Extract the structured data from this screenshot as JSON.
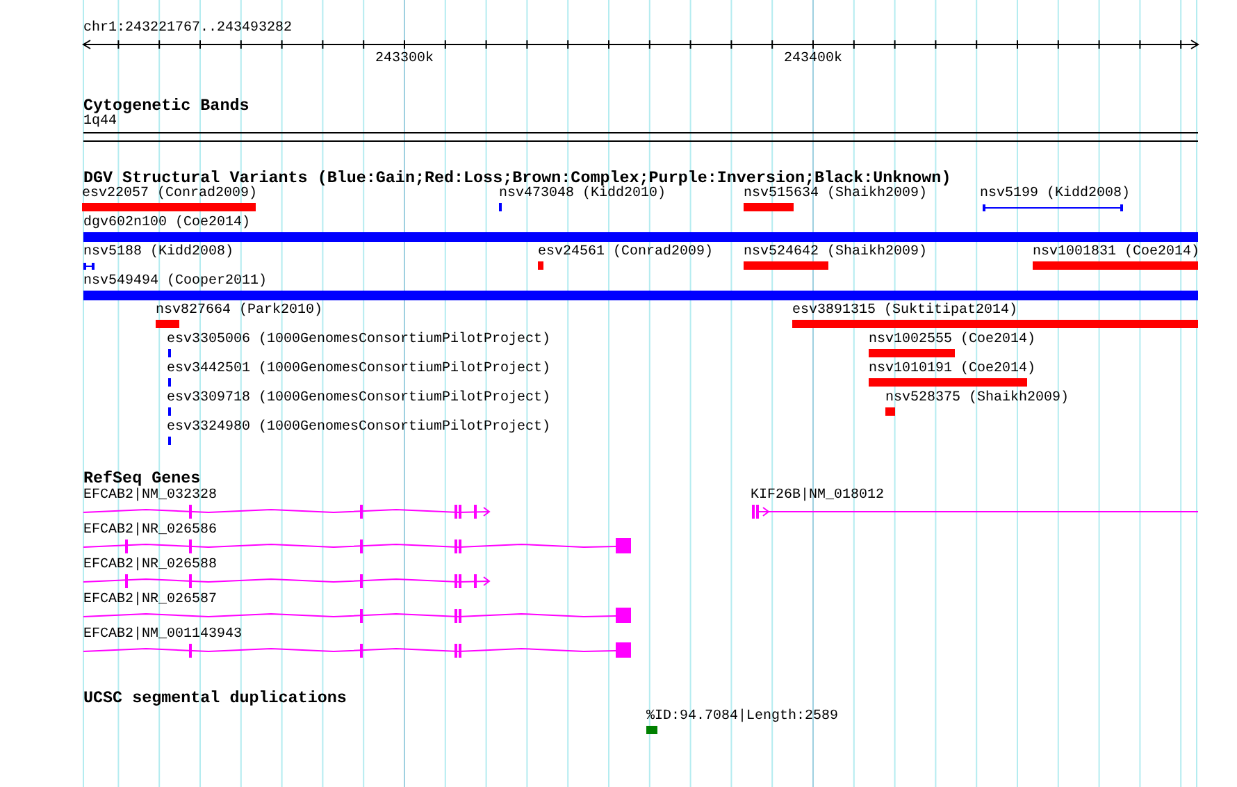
{
  "position": "chr1:243221767..243493282",
  "ruler": {
    "ticks": [
      {
        "label": "243300k"
      },
      {
        "label": "243400k"
      }
    ]
  },
  "tracks": [
    {
      "kind": "bands",
      "title": "Cytogenetic Bands",
      "items": [
        {
          "label": "1q44"
        }
      ]
    },
    {
      "kind": "variants",
      "title": "DGV Structural Variants (Blue:Gain;Red:Loss;Brown:Complex;Purple:Inversion;Black:Unknown)",
      "lanes": [
        {
          "features": [
            {
              "label": "esv22057 (Conrad2009)",
              "color": "#ff0000",
              "kind": "bar"
            },
            {
              "label": "nsv473048 (Kidd2010)",
              "color": "#0000ff",
              "kind": "bar"
            },
            {
              "label": "nsv515634 (Shaikh2009)",
              "color": "#ff0000",
              "kind": "bar"
            },
            {
              "label": "nsv5199 (Kidd2008)",
              "color": "#0000ff",
              "kind": "interval"
            }
          ]
        },
        {
          "features": [
            {
              "label": "dgv602n100 (Coe2014)",
              "color": "#0000ff",
              "kind": "bar"
            }
          ]
        },
        {
          "features": [
            {
              "label": "nsv5188 (Kidd2008)",
              "color": "#0000ff",
              "kind": "interval"
            },
            {
              "label": "esv24561 (Conrad2009)",
              "color": "#ff0000",
              "kind": "bar"
            },
            {
              "label": "nsv524642 (Shaikh2009)",
              "color": "#ff0000",
              "kind": "bar"
            },
            {
              "label": "nsv1001831 (Coe2014)",
              "color": "#ff0000",
              "kind": "bar"
            }
          ]
        },
        {
          "features": [
            {
              "label": "nsv549494 (Cooper2011)",
              "color": "#0000ff",
              "kind": "bar"
            }
          ]
        },
        {
          "features": [
            {
              "label": "nsv827664 (Park2010)",
              "color": "#ff0000",
              "kind": "bar"
            },
            {
              "label": "esv3891315 (Suktitipat2014)",
              "color": "#ff0000",
              "kind": "bar"
            }
          ]
        },
        {
          "features": [
            {
              "label": "esv3305006 (1000GenomesConsortiumPilotProject)",
              "color": "#0000ff",
              "kind": "bar"
            },
            {
              "label": "nsv1002555 (Coe2014)",
              "color": "#ff0000",
              "kind": "bar"
            }
          ]
        },
        {
          "features": [
            {
              "label": "esv3442501 (1000GenomesConsortiumPilotProject)",
              "color": "#0000ff",
              "kind": "bar"
            },
            {
              "label": "nsv1010191 (Coe2014)",
              "color": "#ff0000",
              "kind": "bar"
            }
          ]
        },
        {
          "features": [
            {
              "label": "esv3309718 (1000GenomesConsortiumPilotProject)",
              "color": "#0000ff",
              "kind": "bar"
            },
            {
              "label": "nsv528375 (Shaikh2009)",
              "color": "#ff0000",
              "kind": "bar"
            }
          ]
        },
        {
          "features": [
            {
              "label": "esv3324980 (1000GenomesConsortiumPilotProject)",
              "color": "#0000ff",
              "kind": "bar"
            }
          ]
        }
      ]
    },
    {
      "kind": "genes",
      "title": "RefSeq Genes",
      "lanes": [
        {
          "genes": [
            {
              "label": "EFCAB2|NM_032328"
            },
            {
              "label": "KIF26B|NM_018012"
            }
          ]
        },
        {
          "genes": [
            {
              "label": "EFCAB2|NR_026586"
            }
          ]
        },
        {
          "genes": [
            {
              "label": "EFCAB2|NR_026588"
            }
          ]
        },
        {
          "genes": [
            {
              "label": "EFCAB2|NR_026587"
            }
          ]
        },
        {
          "genes": [
            {
              "label": "EFCAB2|NM_001143943"
            }
          ]
        }
      ]
    },
    {
      "kind": "dups",
      "title": "UCSC segmental duplications",
      "items": [
        {
          "label": "%ID:94.7084|Length:2589",
          "color": "#008000"
        }
      ]
    }
  ]
}
